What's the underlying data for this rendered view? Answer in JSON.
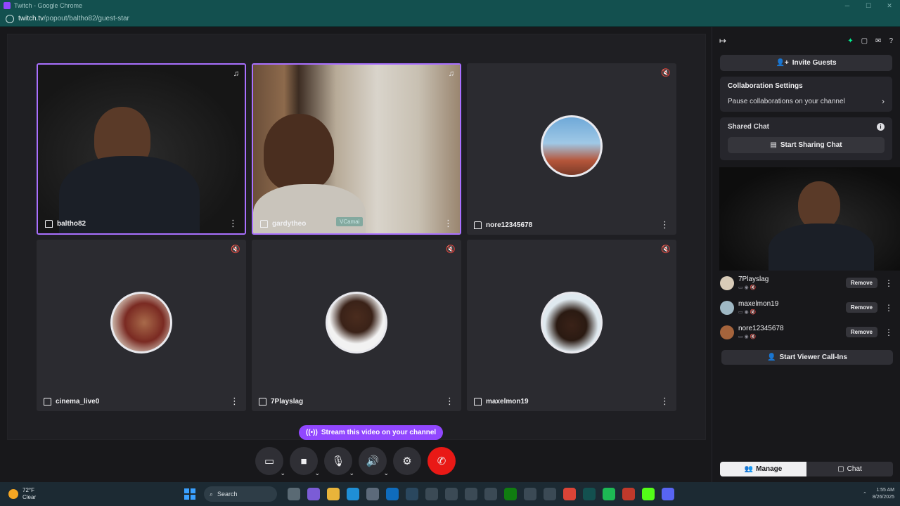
{
  "browser": {
    "window_title": "Twitch - Google Chrome",
    "url_host": "twitch.tv",
    "url_path": "/popout/baltho82/guest-star"
  },
  "tiles": [
    {
      "name": "baltho82",
      "active": true,
      "status": "speaking"
    },
    {
      "name": "gardytheo",
      "active": true,
      "status": "speaking",
      "overlay": "VCamai"
    },
    {
      "name": "nore12345678",
      "active": false,
      "status": "muted"
    },
    {
      "name": "cinema_live0",
      "active": false,
      "status": "muted"
    },
    {
      "name": "7Playslag",
      "active": false,
      "status": "muted"
    },
    {
      "name": "maxelmon19",
      "active": false,
      "status": "muted"
    }
  ],
  "stream_button": "Stream this video on your channel",
  "controls": {
    "screen": "screen-share-icon",
    "camera": "camera-icon",
    "mic": "mic-icon",
    "speaker": "speaker-icon",
    "settings": "gear-icon",
    "end": "end-call-icon"
  },
  "panel": {
    "invite_label": "Invite Guests",
    "collab_title": "Collaboration Settings",
    "collab_row": "Pause collaborations on your channel",
    "shared_title": "Shared Chat",
    "share_button": "Start Sharing Chat",
    "guests": [
      {
        "name": "7Playslag",
        "action": "Remove"
      },
      {
        "name": "maxelmon19",
        "action": "Remove"
      },
      {
        "name": "nore12345678",
        "action": "Remove"
      }
    ],
    "callin_label": "Start Viewer Call-Ins",
    "tabs": {
      "manage": "Manage",
      "chat": "Chat"
    }
  },
  "taskbar": {
    "temp": "72°F",
    "condition": "Clear",
    "search": "Search",
    "time": "1:55 AM",
    "date": "8/26/2025"
  },
  "colors": {
    "accent": "#9147ff",
    "end_call": "#e91916",
    "mic_active": "#00f593"
  }
}
